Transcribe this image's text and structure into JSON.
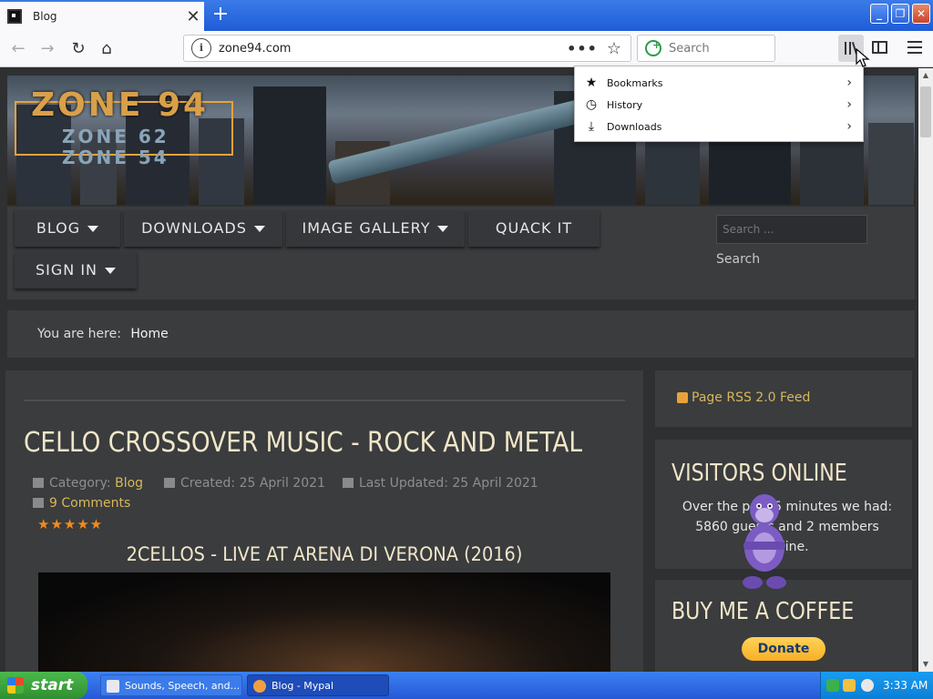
{
  "browser": {
    "tab_title": "Blog",
    "tab_close": "✕",
    "new_tab": "+",
    "url": "zone94.com",
    "url_info": "i",
    "page_actions": "•••",
    "bookmark_star": "☆",
    "search_placeholder": "Search",
    "nav_back": "←",
    "nav_forward": "→",
    "nav_reload": "↻",
    "nav_home": "⌂"
  },
  "window_controls": {
    "minimize": "_",
    "restore": "❐",
    "close": "✕"
  },
  "library_menu": {
    "items": [
      {
        "icon": "★",
        "label": "Bookmarks",
        "arrow": "›"
      },
      {
        "icon": "◷",
        "label": "History",
        "arrow": "›"
      },
      {
        "icon": "⤓",
        "label": "Downloads",
        "arrow": "›"
      }
    ]
  },
  "site": {
    "banner_title": "ZONE 94",
    "banner_sub1": "ZONE 62",
    "banner_sub2": "ZONE 54",
    "nav": [
      {
        "label": "BLOG"
      },
      {
        "label": "DOWNLOADS"
      },
      {
        "label": "IMAGE GALLERY"
      },
      {
        "label": "QUACK IT"
      },
      {
        "label": "SIGN IN"
      }
    ],
    "search_placeholder": "Search ...",
    "search_button": "Search",
    "breadcrumb_prefix": "You are here:",
    "breadcrumb_home": "Home"
  },
  "article": {
    "title": "CELLO CROSSOVER MUSIC - ROCK AND METAL",
    "category_label": "Category:",
    "category_value": "Blog",
    "created": "Created: 25 April 2021",
    "updated": "Last Updated: 25 April 2021",
    "comments": "9 Comments",
    "stars": "★★★★★",
    "video_title": "2CELLOS - LIVE AT ARENA DI VERONA (2016)"
  },
  "sidebar": {
    "rss": "Page RSS 2.0 Feed",
    "visitors_title": "VISITORS ONLINE",
    "visitors_line1": "Over the past 5 minutes we had:",
    "visitors_line2": "5860 guests and 2 members",
    "visitors_line3": "online.",
    "coffee_title": "BUY ME A COFFEE",
    "donate": "Donate"
  },
  "taskbar": {
    "start": "start",
    "items": [
      {
        "label": "Sounds, Speech, and..."
      },
      {
        "label": "Blog - Mypal"
      }
    ],
    "clock": "3:33 AM"
  }
}
